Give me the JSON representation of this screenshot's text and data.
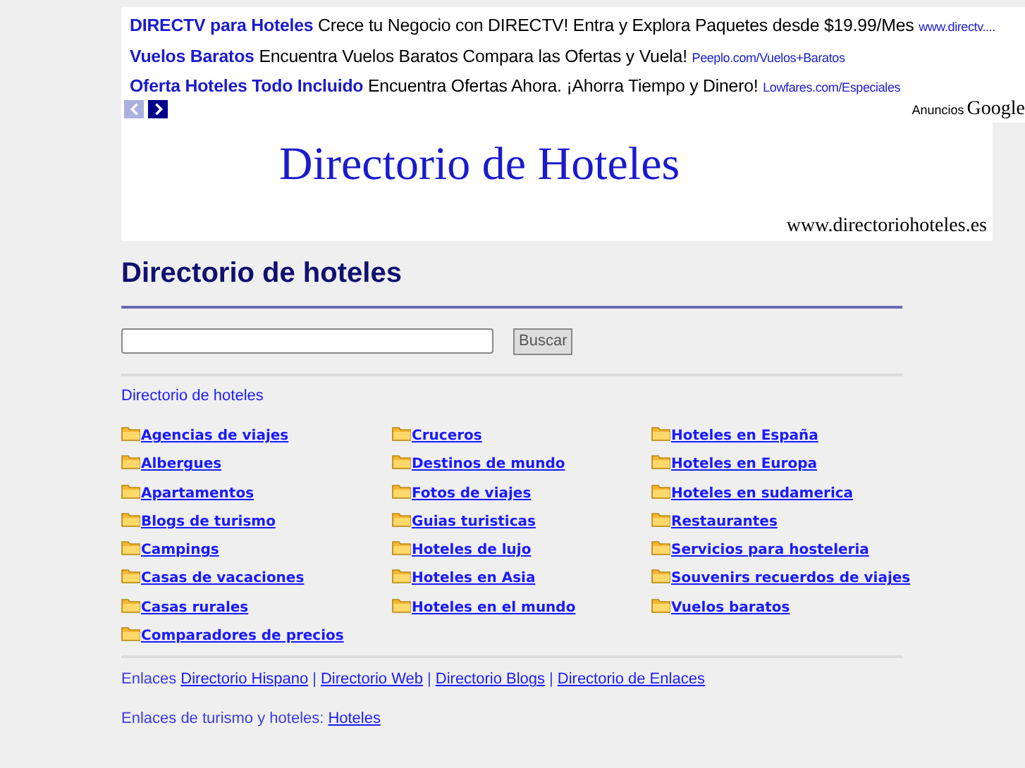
{
  "ads": [
    {
      "title": "DIRECTV para Hoteles",
      "text": "Crece tu Negocio con DIRECTV! Entra y Explora Paquetes desde $19.99/Mes",
      "url": "www.directv...."
    },
    {
      "title": "Vuelos Baratos",
      "text": "Encuentra Vuelos Baratos Compara las Ofertas y Vuela!",
      "url": "Peeplo.com/Vuelos+Baratos"
    },
    {
      "title": "Oferta Hoteles Todo Incluido",
      "text": "Encuentra Ofertas Ahora. ¡Ahorra Tiempo y Dinero!",
      "url": "Lowfares.com/Especiales"
    }
  ],
  "ad_nav": [
    {
      "kind": "prev",
      "disabled": true
    },
    {
      "kind": "next",
      "disabled": false
    }
  ],
  "ad_label": "Anuncios",
  "ad_brand": "Google",
  "banner": {
    "title": "Directorio de Hoteles",
    "url": "www.directoriohoteles.es"
  },
  "heading": "Directorio de hoteles",
  "search": {
    "button": "Buscar"
  },
  "breadcrumb": "Directorio de hoteles",
  "categories": [
    [
      "Agencias de viajes",
      "Albergues",
      "Apartamentos",
      "Blogs de turismo",
      "Campings",
      "Casas de vacaciones",
      "Casas rurales",
      "Comparadores de precios"
    ],
    [
      "Cruceros",
      "Destinos de mundo",
      "Fotos de viajes",
      "Guias turisticas",
      "Hoteles de lujo",
      "Hoteles en Asia",
      "Hoteles en el mundo"
    ],
    [
      "Hoteles en España",
      "Hoteles en Europa",
      "Hoteles en sudamerica",
      "Restaurantes",
      "Servicios para hosteleria",
      "Souvenirs recuerdos de viajes",
      "Vuelos baratos"
    ]
  ],
  "links_label": "Enlaces",
  "links": [
    "Directorio Hispano",
    "Directorio Web",
    "Directorio Blogs",
    "Directorio de Enlaces"
  ],
  "links_separator": "|",
  "tourism_label": "Enlaces de turismo y hoteles:",
  "tourism_links": [
    "Hoteles"
  ]
}
